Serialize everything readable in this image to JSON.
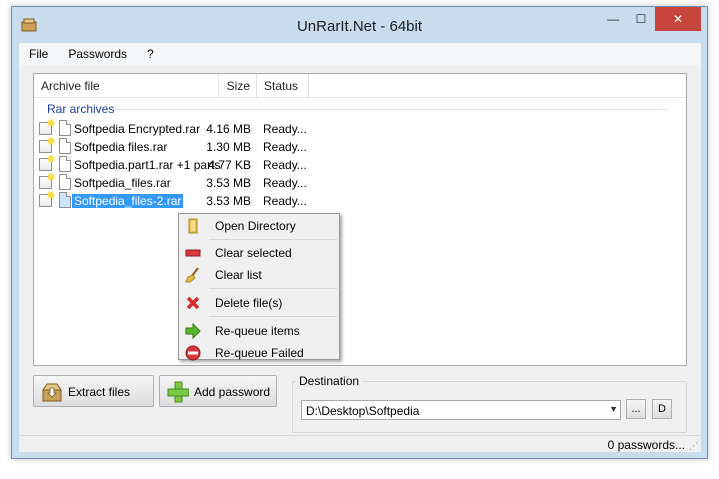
{
  "window": {
    "title": "UnRarIt.Net - 64bit",
    "min_glyph": "—",
    "max_glyph": "☐",
    "close_glyph": "✕"
  },
  "menu": [
    "File",
    "Passwords",
    "?"
  ],
  "list": {
    "columns": [
      "Archive file",
      "Size",
      "Status"
    ],
    "group": "Rar archives",
    "rows": [
      {
        "name": "Softpedia Encrypted.rar",
        "size": "4.16 MB",
        "status": "Ready..."
      },
      {
        "name": "Softpedia files.rar",
        "size": "1.30 MB",
        "status": "Ready..."
      },
      {
        "name": "Softpedia.part1.rar +1 parts",
        "size": "4.77 KB",
        "status": "Ready..."
      },
      {
        "name": "Softpedia_files.rar",
        "size": "3.53 MB",
        "status": "Ready..."
      },
      {
        "name": "Softpedia_files-2.rar",
        "size": "3.53 MB",
        "status": "Ready..."
      }
    ]
  },
  "context_menu": {
    "items": [
      {
        "label": "Open Directory",
        "icon": "folder-icon"
      },
      {
        "label": "Clear selected",
        "icon": "minus-icon"
      },
      {
        "label": "Clear list",
        "icon": "broom-icon"
      },
      {
        "label": "Delete file(s)",
        "icon": "delete-x-icon"
      },
      {
        "label": "Re-queue items",
        "icon": "arrow-right-icon"
      },
      {
        "label": "Re-queue Failed",
        "icon": "no-entry-icon"
      }
    ]
  },
  "buttons": {
    "extract": "Extract files",
    "add_password": "Add password"
  },
  "destination": {
    "label": "Destination",
    "value": "D:\\Desktop\\Softpedia",
    "browse_label": "...",
    "d_label": "D"
  },
  "status": {
    "text": "0 passwords..."
  }
}
